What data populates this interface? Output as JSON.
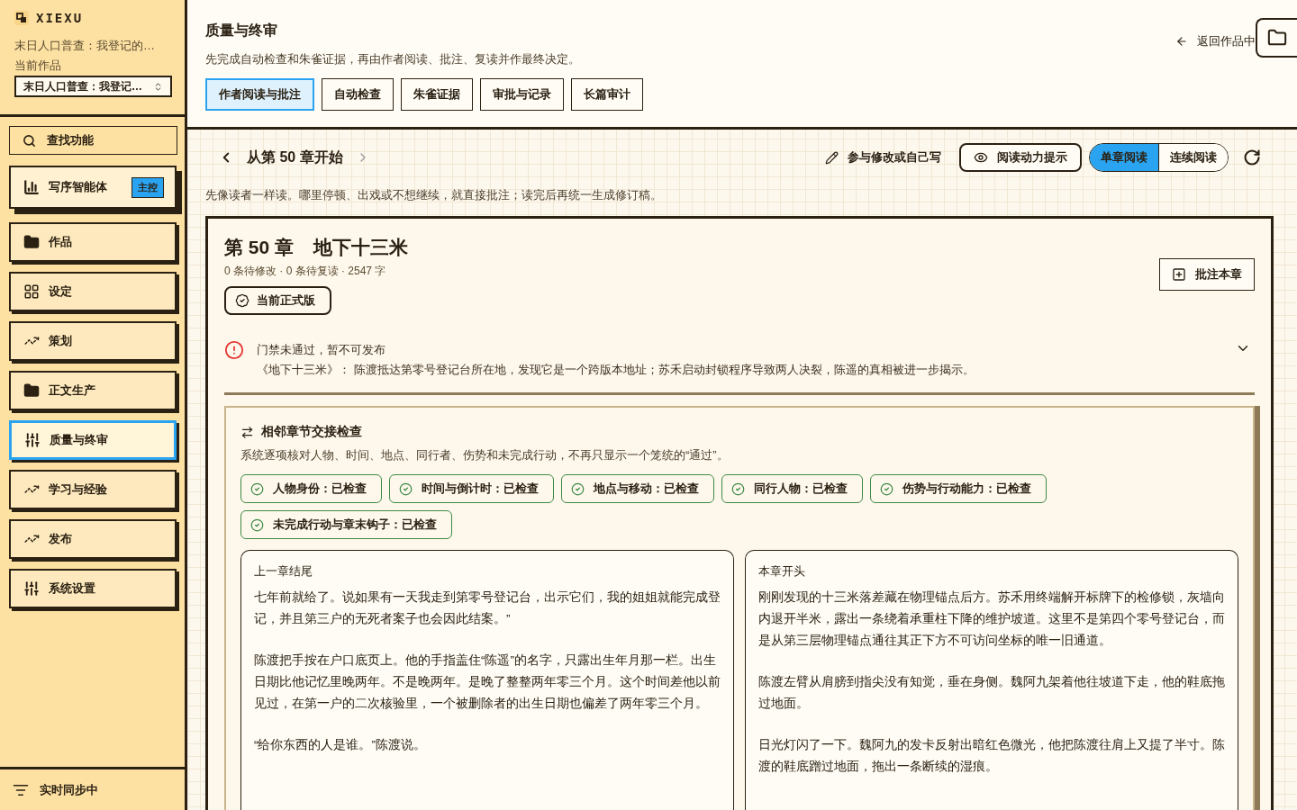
{
  "sidebar": {
    "logo": "XIEXU",
    "project_title": "末日人口普查：我登记的…",
    "current_label": "当前作品",
    "project_select": "末日人口普查：我登记…",
    "search_label": "查找功能",
    "nav_items": [
      {
        "label": "写序智能体",
        "badge": "主控",
        "selected": false
      },
      {
        "label": "作品",
        "selected": false
      },
      {
        "label": "设定",
        "selected": false
      },
      {
        "label": "策划",
        "selected": false
      },
      {
        "label": "正文生产",
        "selected": false
      },
      {
        "label": "质量与终审",
        "selected": true
      },
      {
        "label": "学习与经验",
        "selected": false
      },
      {
        "label": "发布",
        "selected": false
      },
      {
        "label": "系统设置",
        "selected": false
      }
    ],
    "sync_status": "实时同步中"
  },
  "header": {
    "title": "质量与终审",
    "subtitle": "先完成自动检查和朱雀证据，再由作者阅读、批注、复读并作最终决定。",
    "back_link": "返回作品中",
    "tabs": [
      {
        "label": "作者阅读与批注",
        "selected": true
      },
      {
        "label": "自动检查",
        "selected": false
      },
      {
        "label": "朱雀证据",
        "selected": false
      },
      {
        "label": "审批与记录",
        "selected": false
      },
      {
        "label": "长篇审计",
        "selected": false
      }
    ]
  },
  "toolbar": {
    "chapter_nav": "从第 50 章开始",
    "edit_button": "参与修改或自己写",
    "hint_toggle": "阅读动力提示",
    "modes": [
      {
        "label": "单章阅读",
        "selected": true
      },
      {
        "label": "连续阅读",
        "selected": false
      }
    ]
  },
  "intro": "先像读者一样读。哪里停顿、出戏或不想继续，就直接批注；读完后再统一生成修订稿。",
  "chapter": {
    "number": "第 50 章",
    "name": "地下十三米",
    "meta": "0 条待修改 · 0 条待复读 · 2547 字",
    "version_badge": "当前正式版",
    "annotate_button": "批注本章",
    "alert": {
      "title": "门禁未通过，暂不可发布",
      "body": "《地下十三米》： 陈渡抵达第零号登记台所在地，发现它是一个跨版本地址；苏禾启动封锁程序导致两人决裂，陈遥的真相被进一步揭示。",
      "expanded": false
    },
    "handoff": {
      "title": "相邻章节交接检查",
      "description": "系统逐项核对人物、时间、地点、同行者、伤势和未完成行动，不再只显示一个笼统的“通过”。",
      "checks": [
        {
          "label": "人物身份：已检查",
          "passed": true
        },
        {
          "label": "时间与倒计时：已检查",
          "passed": true
        },
        {
          "label": "地点与移动：已检查",
          "passed": true
        },
        {
          "label": "同行人物：已检查",
          "passed": true
        },
        {
          "label": "伤势与行动能力：已检查",
          "passed": true
        },
        {
          "label": "未完成行动与章末钩子：已检查",
          "passed": true
        }
      ],
      "excerpts": [
        {
          "heading": "上一章结尾",
          "paragraphs": [
            "七年前就给了。说如果有一天我走到第零号登记台，出示它们，我的姐姐就能完成登记，并且第三户的无死者案子也会因此结案。”",
            "陈渡把手按在户口底页上。他的手指盖住“陈遥”的名字，只露出生年月那一栏。出生日期比他记忆里晚两年。不是晚两年。是晚了整整两年零三个月。这个时间差他以前见过，在第一户的二次核验里，一个被删除者的出生日期也偏差了两年零三个月。",
            "“给你东西的人是谁。”陈渡说。"
          ]
        },
        {
          "heading": "本章开头",
          "paragraphs": [
            "刚刚发现的十三米落差藏在物理锚点后方。苏禾用终端解开标牌下的检修锁，灰墙向内退开半米，露出一条绕着承重柱下降的维护坡道。这里不是第四个零号登记台，而是从第三层物理锚点通往其正下方不可访问坐标的唯一旧通道。",
            "陈渡左臂从肩膀到指尖没有知觉，垂在身侧。魏阿九架着他往坡道下走，他的鞋底拖过地面。",
            "日光灯闪了一下。魏阿九的发卡反射出暗红色微光，他把陈渡往肩上又提了半寸。陈渡的鞋底蹭过地面，拖出一条断续的湿痕。"
          ]
        }
      ]
    }
  }
}
